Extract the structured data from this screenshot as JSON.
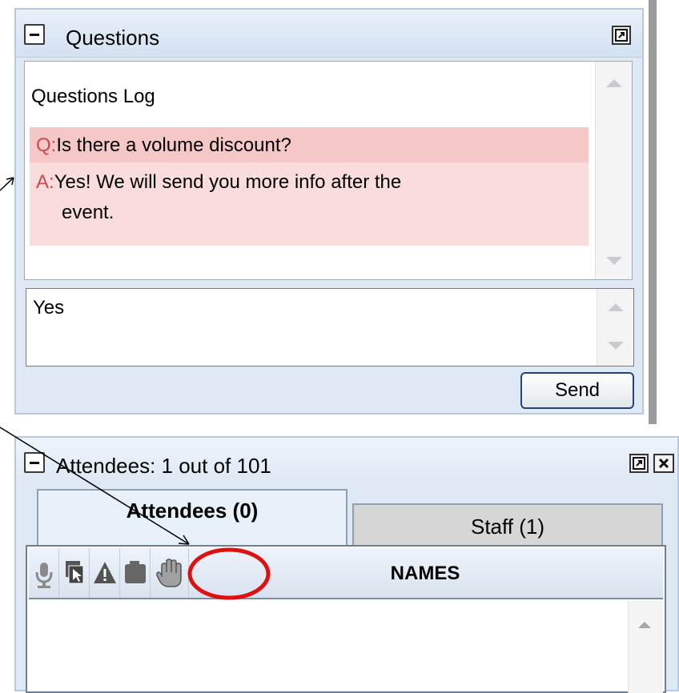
{
  "questions_panel": {
    "title": "Questions",
    "log_label": "Questions Log",
    "entries": [
      {
        "prefix": "Q:",
        "text": "Is there a volume discount?"
      },
      {
        "prefix": "A:",
        "text": "Yes! We will send you more info after the",
        "text2": "event."
      }
    ],
    "input_value": "Yes",
    "send_label": "Send"
  },
  "attendees_panel": {
    "title": "Attendees:  1 out of 101",
    "tabs": [
      {
        "label": "Attendees (0)",
        "selected": true
      },
      {
        "label": "Staff (1)",
        "selected": false
      }
    ],
    "column_icons": [
      "microphone-icon",
      "screen-share-icon",
      "warning-icon",
      "camera-icon",
      "raise-hand-icon"
    ],
    "names_header": "NAMES"
  },
  "annotation": {
    "highlight_color": "#e01010",
    "arrow_color": "#000000"
  }
}
